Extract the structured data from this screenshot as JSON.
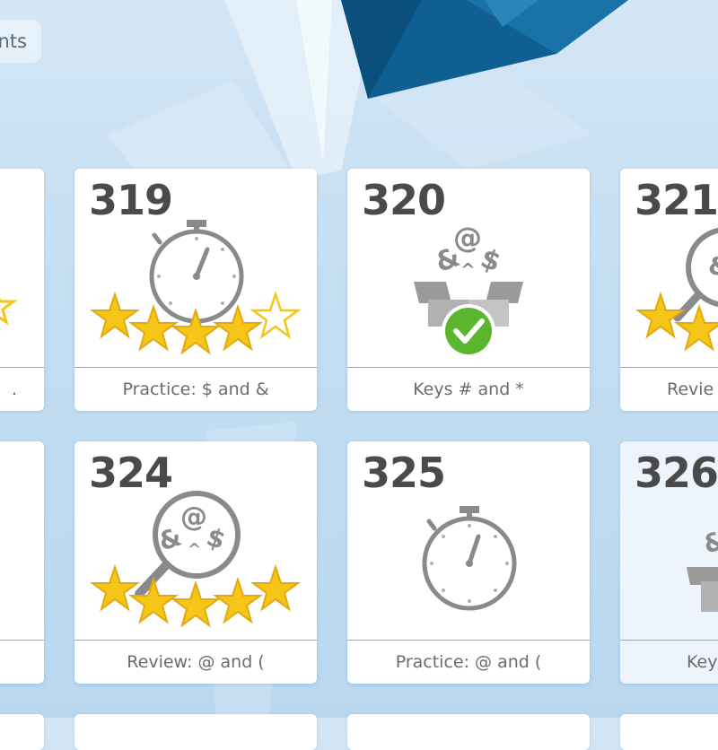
{
  "top_tab": {
    "label": "nts"
  },
  "cards": [
    {
      "number": "",
      "title": ".",
      "icon": "stopwatch-icon",
      "stars": 5,
      "stars_filled": 4
    },
    {
      "number": "319",
      "title": "Practice: $ and &",
      "icon": "stopwatch-icon",
      "stars": 5,
      "stars_filled": 4
    },
    {
      "number": "320",
      "title": "Keys # and *",
      "icon": "open-box-symbols-icon",
      "completed": true
    },
    {
      "number": "321",
      "title": "Revie",
      "icon": "magnifier-symbols-icon",
      "stars": 5,
      "stars_filled": 2
    },
    {
      "number": "",
      "title": "",
      "icon": ""
    },
    {
      "number": "324",
      "title": "Review: @ and (",
      "icon": "magnifier-symbols-icon",
      "stars": 5,
      "stars_filled": 5
    },
    {
      "number": "325",
      "title": "Practice: @ and (",
      "icon": "stopwatch-icon"
    },
    {
      "number": "326",
      "title": "Key",
      "icon": "open-box-symbols-icon"
    }
  ],
  "colors": {
    "star_gold": "#f5c518",
    "check_green": "#5cb52e",
    "icon_gray": "#8a8a8a",
    "background": "#c4def2",
    "crystal_blue": "#0c5a8c"
  }
}
